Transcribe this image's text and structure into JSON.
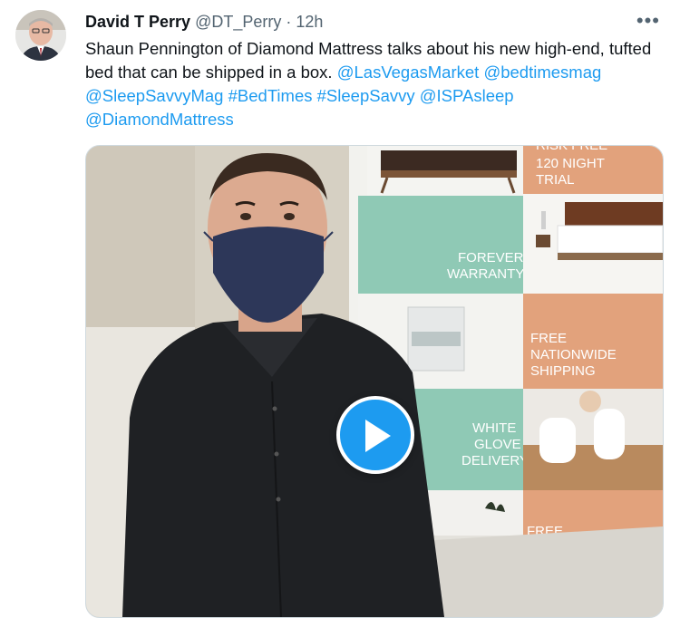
{
  "tweet": {
    "author_name": "David T Perry",
    "handle": "@DT_Perry",
    "separator": "·",
    "time": "12h",
    "more_label": "•••",
    "text_plain": "Shaun Pennington of Diamond Mattress talks about his new high-end, tufted bed that can be shipped in a box.",
    "mentions": [
      "@LasVegasMarket",
      "@bedtimesmag",
      "@SleepSavvyMag",
      "#BedTimes",
      "#SleepSavvy",
      "@ISPAsleep",
      "@DiamondMattress"
    ]
  },
  "video": {
    "backdrop_panels": {
      "trial_top": "RISK FREE",
      "trial_line1": "120 NIGHT",
      "trial_line2": "TRIAL",
      "warranty_line1": "FOREVER",
      "warranty_line2": "WARRANTY",
      "shipping_line1": "FREE",
      "shipping_line2": "NATIONWIDE",
      "shipping_line3": "SHIPPING",
      "glove_line1": "WHITE",
      "glove_line2": "GLOVE",
      "glove_line3": "DELIVERY",
      "bottom_text": "FREE"
    },
    "play_icon": "play-icon"
  },
  "colors": {
    "link": "#1d9bf0",
    "panel_peach": "#e2a27c",
    "panel_mint": "#8fc9b5"
  }
}
